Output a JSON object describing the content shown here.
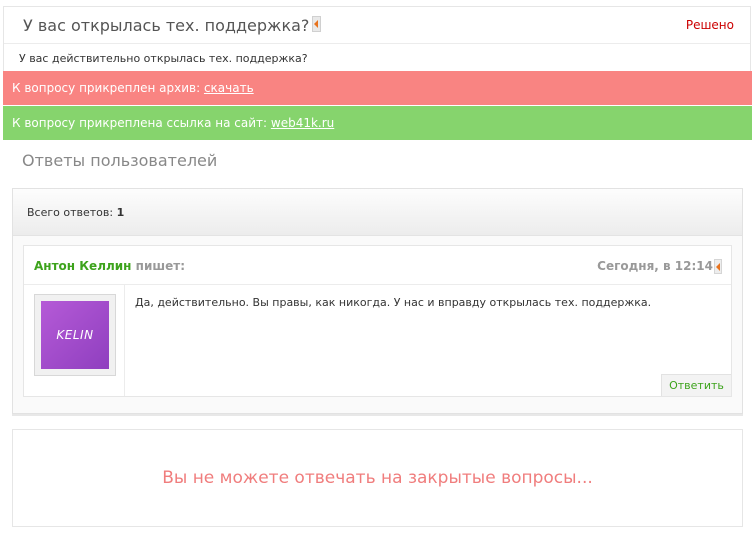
{
  "question": {
    "title": "У вас открылась тех. поддержка?",
    "title_icon": "arrow-left-icon",
    "status": "Решено",
    "body": "У вас действительно открылась тех. поддержка?"
  },
  "attachments": {
    "archive_text": "К вопросу прикреплен архив:",
    "archive_link": "скачать",
    "site_text": "К вопросу прикреплена ссылка на сайт:",
    "site_link": "web41k.ru"
  },
  "answers": {
    "title": "Ответы пользователей",
    "count_label": "Всего ответов:",
    "count": "1",
    "items": [
      {
        "author": "Антон Келлин",
        "verb": "пишет:",
        "date": "Сегодня, в 12:14",
        "avatar_text": "KELIN",
        "text": "Да, действительно. Вы правы, как никогда. У нас и вправду открылась тех. поддержка.",
        "reply_label": "Ответить"
      }
    ]
  },
  "closed_notice": "Вы не можете отвечать на закрытые вопросы...",
  "colors": {
    "red_bar": "#f98482",
    "green_bar": "#86d46d",
    "author": "#3da31c",
    "status": "#cc0000",
    "closed_text": "#f07d7d"
  }
}
